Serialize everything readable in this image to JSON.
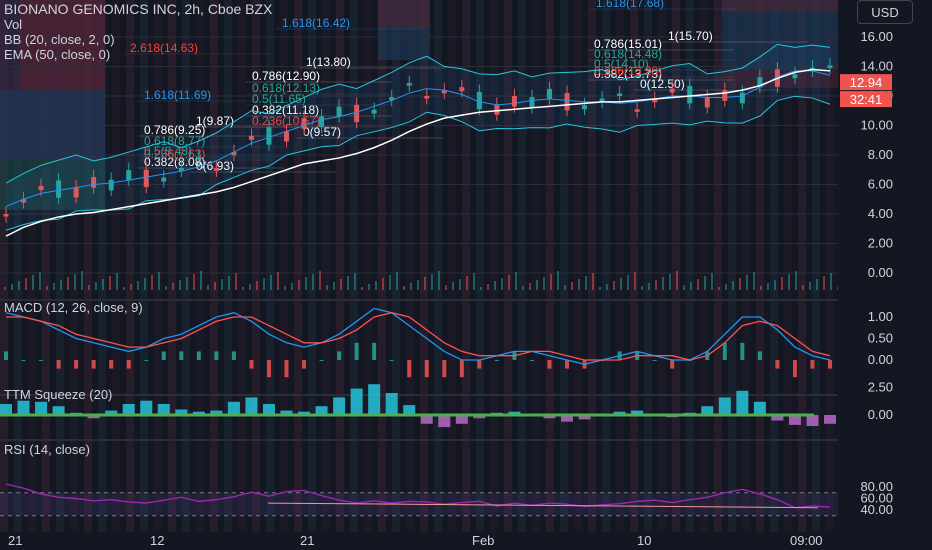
{
  "header": {
    "title": "BIONANO GENOMICS INC, 2h, Cboe BZX",
    "vol_label": "Vol",
    "bb_label": "BB (20, close, 2, 0)",
    "ema_label": "EMA (50, close, 0)",
    "currency_button": "USD"
  },
  "colors": {
    "background": "#131722",
    "up": "#26a69a",
    "down": "#ef5350",
    "ema": "#ffffff",
    "bollinger": "#2196f3",
    "macd_line": "#2196f3",
    "signal_line": "#ff5252",
    "squeeze_up": "#26c6da",
    "squeeze_down": "#ba68c8",
    "rsi": "#9c27b0",
    "fib_236": "#f44336",
    "fib_382": "#ffffff",
    "fib_618": "#26a69a",
    "fib_786": "#ffffff",
    "fib_1618": "#2196f3"
  },
  "price_axis": {
    "labels": [
      "16.00",
      "14.00",
      "12.00",
      "10.00",
      "8.00",
      "6.00",
      "4.00",
      "2.00",
      "0.00"
    ],
    "current_price": "12.94",
    "countdown": "32:41"
  },
  "time_axis": {
    "labels": [
      "21",
      "12",
      "21",
      "Feb",
      "10",
      "09:00"
    ]
  },
  "fib_labels": [
    {
      "text": "1.618(17.68)",
      "kind": "fib_1618"
    },
    {
      "text": "1.618(16.42)",
      "kind": "fib_1618"
    },
    {
      "text": "2.618(14.63)",
      "kind": "fib_236"
    },
    {
      "text": "1(13.80)",
      "kind": "fib_382"
    },
    {
      "text": "0.786(12.90)",
      "kind": "fib_786"
    },
    {
      "text": "0.618(12.13)",
      "kind": "fib_618"
    },
    {
      "text": "0.5(11.65)",
      "kind": "fib_618"
    },
    {
      "text": "0.382(11.18)",
      "kind": "fib_382"
    },
    {
      "text": "0.236(10.57)",
      "kind": "fib_236"
    },
    {
      "text": "0(9.57)",
      "kind": "fib_382"
    },
    {
      "text": "1.618(11.69)",
      "kind": "fib_1618"
    },
    {
      "text": "1(9.87)",
      "kind": "fib_382"
    },
    {
      "text": "0.786(9.25)",
      "kind": "fib_786"
    },
    {
      "text": "0.618(8.77)",
      "kind": "fib_618"
    },
    {
      "text": "0.5(8.43)",
      "kind": "fib_618"
    },
    {
      "text": "0.382(8.08)",
      "kind": "fib_382"
    },
    {
      "text": "0.236(7.63)",
      "kind": "fib_236"
    },
    {
      "text": "0(6.93)",
      "kind": "fib_382"
    },
    {
      "text": "1(15.70)",
      "kind": "fib_382"
    },
    {
      "text": "0.786(15.01)",
      "kind": "fib_786"
    },
    {
      "text": "0.618(14.48)",
      "kind": "fib_618"
    },
    {
      "text": "0.5(14.10)",
      "kind": "fib_618"
    },
    {
      "text": "0.382(13.73)",
      "kind": "fib_382"
    },
    {
      "text": "0.236(13.28)",
      "kind": "fib_236"
    },
    {
      "text": "0(12.50)",
      "kind": "fib_382"
    }
  ],
  "chart_data": [
    {
      "type": "candlestick",
      "title": "BIONANO GENOMICS INC, 2h, Cboe BZX",
      "ylim": [
        -1,
        18
      ],
      "series": [
        {
          "name": "EMA (50, close, 0)",
          "values": [
            2.5,
            3.1,
            3.5,
            3.8,
            4.0,
            4.1,
            4.3,
            4.5,
            4.7,
            4.9,
            5.1,
            5.3,
            5.5,
            5.8,
            6.2,
            6.6,
            7.0,
            7.4,
            7.6,
            7.8,
            8.1,
            8.5,
            9.0,
            9.6,
            10.1,
            10.5,
            10.7,
            10.9,
            11.0,
            11.1,
            11.2,
            11.3,
            11.4,
            11.5,
            11.6,
            11.6,
            11.7,
            11.8,
            11.9,
            12.0,
            12.1,
            12.2,
            12.4,
            12.7,
            13.2,
            13.6,
            13.8,
            13.7
          ]
        },
        {
          "name": "BB (20, close, 2, 0)",
          "values": [
            4.5,
            5.0,
            5.4,
            5.6,
            5.8,
            6.0,
            6.1,
            6.3,
            6.5,
            6.7,
            6.9,
            7.2,
            7.6,
            8.2,
            8.8,
            9.2,
            9.6,
            10.0,
            10.4,
            10.6,
            10.9,
            11.3,
            11.7,
            12.2,
            12.5,
            12.4,
            12.1,
            11.6,
            11.4,
            11.5,
            11.7,
            11.8,
            11.7,
            11.6,
            11.6,
            11.5,
            11.6,
            11.8,
            12.0,
            12.0,
            11.9,
            11.9,
            12.0,
            12.6,
            13.3,
            13.7,
            13.7,
            13.4
          ]
        }
      ]
    },
    {
      "type": "line",
      "title": "MACD (12, 26, close, 9)",
      "ylim": [
        -0.2,
        1.5
      ],
      "series": [
        {
          "name": "MACD",
          "values": [
            1.1,
            1.0,
            0.9,
            0.7,
            0.5,
            0.4,
            0.3,
            0.2,
            0.3,
            0.5,
            0.6,
            0.8,
            1.0,
            1.1,
            0.9,
            0.6,
            0.4,
            0.3,
            0.4,
            0.6,
            0.9,
            1.2,
            1.1,
            0.8,
            0.5,
            0.2,
            0.0,
            0.0,
            0.1,
            0.2,
            0.2,
            0.1,
            0.0,
            -0.1,
            0.0,
            0.1,
            0.2,
            0.1,
            0.0,
            0.0,
            0.2,
            0.6,
            1.0,
            1.0,
            0.7,
            0.3,
            0.1,
            0.0
          ]
        },
        {
          "name": "Signal",
          "values": [
            1.0,
            1.0,
            0.9,
            0.8,
            0.6,
            0.5,
            0.4,
            0.3,
            0.3,
            0.4,
            0.5,
            0.7,
            0.9,
            1.0,
            1.0,
            0.8,
            0.6,
            0.4,
            0.4,
            0.5,
            0.7,
            1.0,
            1.1,
            1.0,
            0.7,
            0.4,
            0.2,
            0.1,
            0.1,
            0.1,
            0.2,
            0.2,
            0.1,
            0.0,
            0.0,
            0.0,
            0.1,
            0.1,
            0.1,
            0.0,
            0.1,
            0.4,
            0.8,
            0.9,
            0.8,
            0.5,
            0.2,
            0.1
          ]
        }
      ]
    },
    {
      "type": "bar",
      "title": "TTM Squeeze (20)",
      "ylim": [
        -1.2,
        3.0
      ],
      "series": [
        {
          "name": "Momentum",
          "values": [
            1.0,
            1.3,
            1.2,
            0.8,
            0.2,
            -0.3,
            0.4,
            1.0,
            1.3,
            1.0,
            0.5,
            0.3,
            0.4,
            1.2,
            1.6,
            1.0,
            0.4,
            0.3,
            0.8,
            1.6,
            2.4,
            2.8,
            2.0,
            0.9,
            -0.8,
            -1.1,
            -0.8,
            -0.3,
            0.2,
            0.3,
            0.1,
            -0.3,
            -0.6,
            -0.4,
            0.1,
            0.3,
            0.4,
            0.1,
            -0.2,
            0.2,
            0.8,
            1.6,
            2.2,
            1.2,
            -0.5,
            -0.9,
            -1.0,
            -0.8
          ]
        }
      ]
    },
    {
      "type": "line",
      "title": "RSI (14, close)",
      "ylim": [
        25,
        100
      ],
      "series": [
        {
          "name": "RSI",
          "values": [
            85,
            78,
            68,
            62,
            60,
            56,
            58,
            54,
            52,
            57,
            62,
            55,
            58,
            63,
            71,
            64,
            72,
            74,
            65,
            57,
            52,
            56,
            52,
            55,
            54,
            50,
            53,
            55,
            47,
            52,
            48,
            52,
            50,
            46,
            49,
            51,
            55,
            57,
            53,
            58,
            62,
            70,
            76,
            68,
            58,
            44,
            47,
            45
          ]
        }
      ]
    }
  ]
}
